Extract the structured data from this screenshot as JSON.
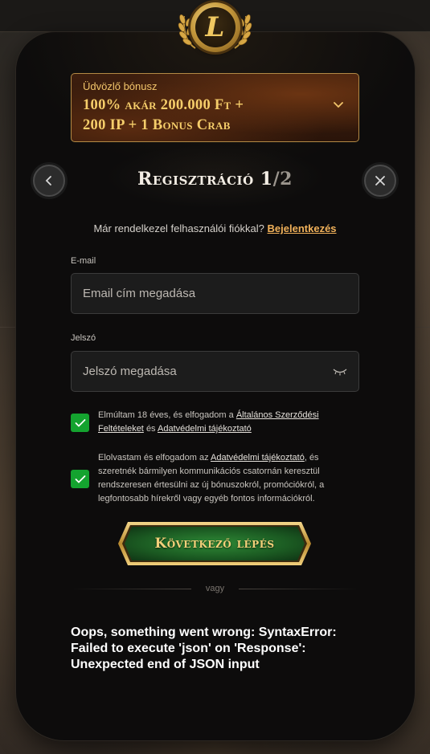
{
  "logo": {
    "letter": "L",
    "icon": "laurel-icon"
  },
  "bonus": {
    "caption": "Üdvözlő bónusz",
    "headline_line1": "100% akár 200.000 Ft +",
    "headline_line2": "200 IP + 1 Bonus Crab",
    "chevron_icon": "chevron-down-icon"
  },
  "header": {
    "title": "Regisztráció 1",
    "step_suffix": "/2",
    "back_icon": "chevron-left-icon",
    "close_icon": "close-icon"
  },
  "login": {
    "prompt": "Már rendelkezel felhasználói fiókkal?",
    "link": "Bejelentkezés"
  },
  "form": {
    "email_label": "E-mail",
    "email_placeholder": "Email cím megadása",
    "password_label": "Jelszó",
    "password_placeholder": "Jelszó megadása"
  },
  "checks": {
    "terms_prefix": "Elmúltam 18 éves, és elfogadom a",
    "terms_link": "Általános Szerződési Feltételeket",
    "terms_and": "és",
    "privacy_link": "Adatvédelmi tájékoztató",
    "marketing_prefix": "Elolvastam és elfogadom az",
    "marketing_link": "Adatvédelmi tájékoztató",
    "marketing_suffix": ", és szeretnék bármilyen kommunikációs csatornán keresztül rendszeresen értesülni az új bónuszokról, promóciókról, a legfontosabb hírekről vagy egyéb fontos információkról.",
    "terms_checked": true,
    "marketing_checked": true
  },
  "next_button": {
    "label": "Következő lépés"
  },
  "divider_text": "vagy",
  "error_message": "Oops, something went wrong: SyntaxError: Failed to execute 'json' on 'Response': Unexpected end of JSON input",
  "colors": {
    "accent_gold": "#f5cd6a",
    "link_orange": "#f0b15a",
    "check_green": "#14a32f",
    "button_green": "#1f6b2a"
  }
}
